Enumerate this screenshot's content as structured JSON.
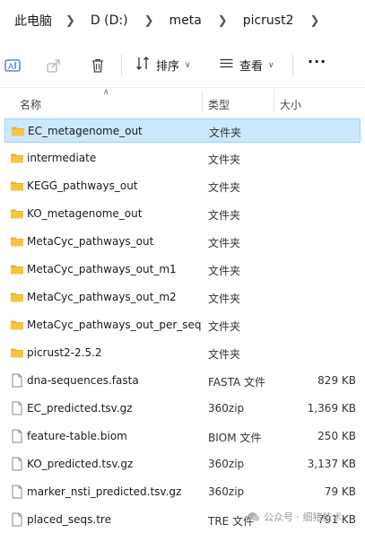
{
  "breadcrumb": [
    "此电脑",
    "D (D:)",
    "meta",
    "picrust2"
  ],
  "toolbar": {
    "sort_label": "排序",
    "view_label": "查看",
    "more_label": "···"
  },
  "columns": {
    "name": "名称",
    "type": "类型",
    "size": "大小"
  },
  "files": [
    {
      "name": "EC_metagenome_out",
      "type": "文件夹",
      "size": "",
      "kind": "folder",
      "selected": true
    },
    {
      "name": "intermediate",
      "type": "文件夹",
      "size": "",
      "kind": "folder"
    },
    {
      "name": "KEGG_pathways_out",
      "type": "文件夹",
      "size": "",
      "kind": "folder"
    },
    {
      "name": "KO_metagenome_out",
      "type": "文件夹",
      "size": "",
      "kind": "folder"
    },
    {
      "name": "MetaCyc_pathways_out",
      "type": "文件夹",
      "size": "",
      "kind": "folder"
    },
    {
      "name": "MetaCyc_pathways_out_m1",
      "type": "文件夹",
      "size": "",
      "kind": "folder"
    },
    {
      "name": "MetaCyc_pathways_out_m2",
      "type": "文件夹",
      "size": "",
      "kind": "folder"
    },
    {
      "name": "MetaCyc_pathways_out_per_seq",
      "type": "文件夹",
      "size": "",
      "kind": "folder"
    },
    {
      "name": "picrust2-2.5.2",
      "type": "文件夹",
      "size": "",
      "kind": "folder"
    },
    {
      "name": "dna-sequences.fasta",
      "type": "FASTA 文件",
      "size": "829 KB",
      "kind": "file"
    },
    {
      "name": "EC_predicted.tsv.gz",
      "type": "360zip",
      "size": "1,369 KB",
      "kind": "file"
    },
    {
      "name": "feature-table.biom",
      "type": "BIOM 文件",
      "size": "250 KB",
      "kind": "file"
    },
    {
      "name": "KO_predicted.tsv.gz",
      "type": "360zip",
      "size": "3,137 KB",
      "kind": "file"
    },
    {
      "name": "marker_nsti_predicted.tsv.gz",
      "type": "360zip",
      "size": "79 KB",
      "kind": "file"
    },
    {
      "name": "placed_seqs.tre",
      "type": "TRE 文件",
      "size": "791 KB",
      "kind": "file"
    }
  ],
  "watermark": "公众号 · 细猪技术",
  "colors": {
    "selection_bg": "#cce8ff",
    "selection_border": "#99d1ff",
    "folder": "#f4c542"
  }
}
